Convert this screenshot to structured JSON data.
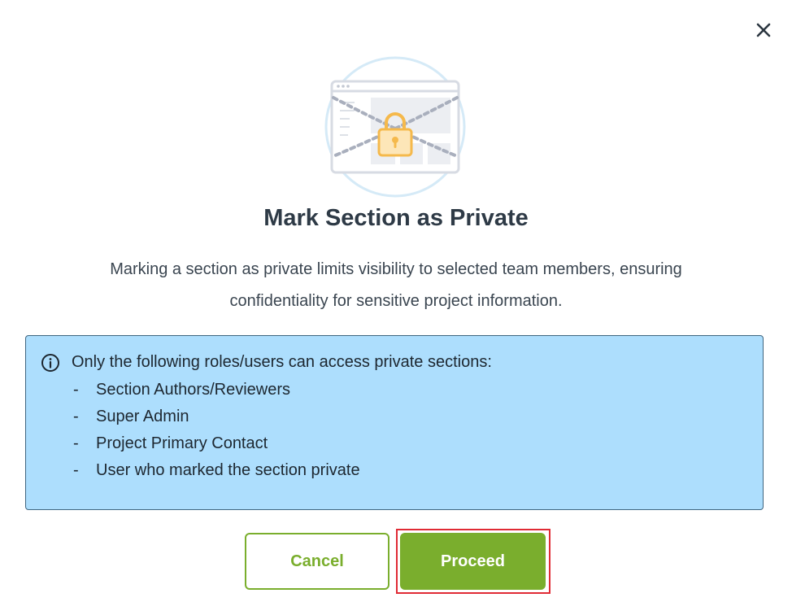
{
  "dialog": {
    "title": "Mark Section as Private",
    "description": "Marking a section as private limits visibility to selected team members, ensuring confidentiality for sensitive project information."
  },
  "icons": {
    "close": "close-icon",
    "info": "info-icon",
    "illustration": "private-section-lock-illustration"
  },
  "info_box": {
    "heading": "Only the following roles/users can access private sections:",
    "items": [
      "Section Authors/Reviewers",
      "Super Admin",
      "Project Primary Contact",
      "User who marked the section private"
    ]
  },
  "buttons": {
    "cancel_label": "Cancel",
    "proceed_label": "Proceed"
  },
  "colors": {
    "accent_green": "#7aae2d",
    "info_background": "#addefd",
    "highlight_red": "#e02b35",
    "lock_orange": "#f5b94c"
  }
}
